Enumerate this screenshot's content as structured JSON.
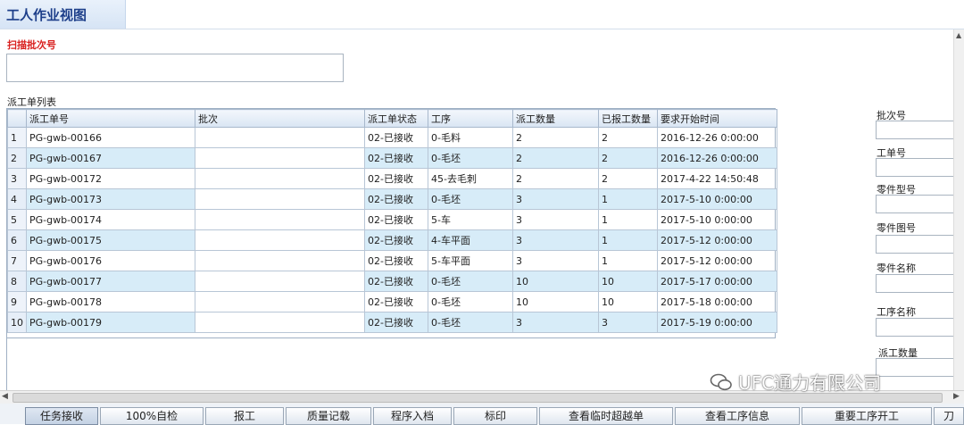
{
  "window": {
    "title": "工人作业视图"
  },
  "scan": {
    "label": "扫描批次号",
    "value": ""
  },
  "list": {
    "label": "派工单列表",
    "columns": [
      "",
      "派工单号",
      "批次",
      "派工单状态",
      "工序",
      "派工数量",
      "已报工数量",
      "要求开始时间"
    ],
    "rows": [
      [
        "1",
        "PG-gwb-00166",
        "",
        "02-已接收",
        "0-毛料",
        "2",
        "2",
        "2016-12-26 0:00:00"
      ],
      [
        "2",
        "PG-gwb-00167",
        "",
        "02-已接收",
        "0-毛坯",
        "2",
        "2",
        "2016-12-26 0:00:00"
      ],
      [
        "3",
        "PG-gwb-00172",
        "",
        "02-已接收",
        "45-去毛刺",
        "2",
        "2",
        "2017-4-22 14:50:48"
      ],
      [
        "4",
        "PG-gwb-00173",
        "",
        "02-已接收",
        "0-毛坯",
        "3",
        "1",
        "2017-5-10 0:00:00"
      ],
      [
        "5",
        "PG-gwb-00174",
        "",
        "02-已接收",
        "5-车",
        "3",
        "1",
        "2017-5-10 0:00:00"
      ],
      [
        "6",
        "PG-gwb-00175",
        "",
        "02-已接收",
        "4-车平面",
        "3",
        "1",
        "2017-5-12 0:00:00"
      ],
      [
        "7",
        "PG-gwb-00176",
        "",
        "02-已接收",
        "5-车平面",
        "3",
        "1",
        "2017-5-12 0:00:00"
      ],
      [
        "8",
        "PG-gwb-00177",
        "",
        "02-已接收",
        "0-毛坯",
        "10",
        "10",
        "2017-5-17 0:00:00"
      ],
      [
        "9",
        "PG-gwb-00178",
        "",
        "02-已接收",
        "0-毛坯",
        "10",
        "10",
        "2017-5-18 0:00:00"
      ],
      [
        "10",
        "PG-gwb-00179",
        "",
        "02-已接收",
        "0-毛坯",
        "3",
        "3",
        "2017-5-19 0:00:00"
      ]
    ]
  },
  "side_fields": [
    "批次号",
    "工单号",
    "零件型号",
    "零件图号",
    "零件名称",
    "工序名称",
    "派工数量"
  ],
  "toolbar": {
    "buttons": [
      "任务接收",
      "100%自检",
      "报工",
      "质量记载",
      "程序入档",
      "标印",
      "查看临时超越单",
      "查看工序信息",
      "重要工序开工",
      "刀"
    ]
  },
  "watermark": {
    "text": "UFC通力有限公司",
    "icon": "wechat-icon"
  }
}
